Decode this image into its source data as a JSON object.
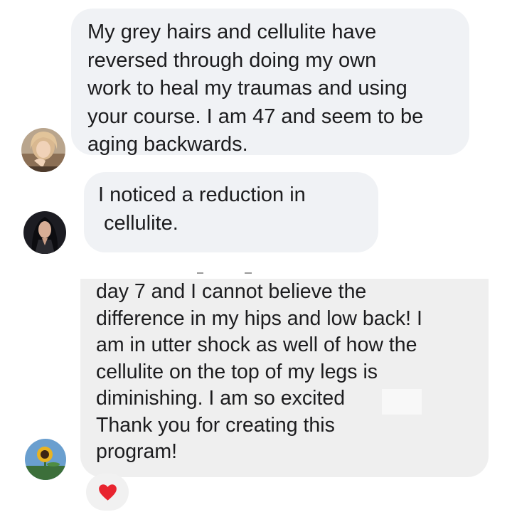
{
  "messages": [
    {
      "lines": [
        "My grey hairs and cellulite have",
        "reversed through doing my own",
        "work to heal my traumas and using",
        "your course. I am 47 and seem to be",
        "aging backwards."
      ]
    },
    {
      "lines": [
        "I noticed a reduction in",
        "cellulite."
      ]
    },
    {
      "lines": [
        "day 7 and I cannot believe the",
        "difference in my hips and low back! I",
        "am in utter shock as well of how the",
        "cellulite on the top of my legs is",
        "diminishing. I am so excited",
        "Thank you for creating this",
        "program!"
      ],
      "reaction_icon": "heart-icon",
      "reaction_color": "#e8242f"
    }
  ],
  "colors": {
    "bubble": "#f0f2f5",
    "bubble_alt": "#efefef",
    "text": "#1c1c1e",
    "reaction": "#e8242f"
  }
}
